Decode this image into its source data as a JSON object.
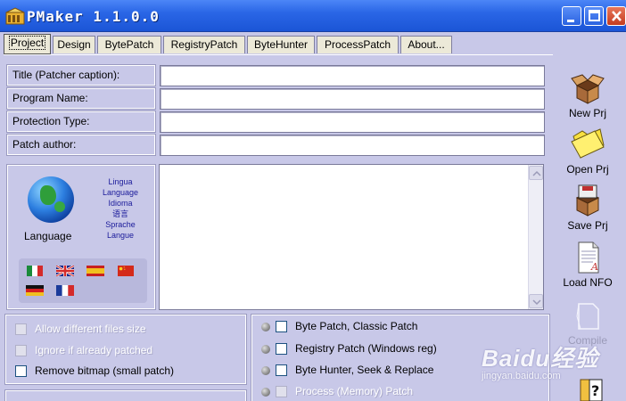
{
  "window": {
    "title": "PMaker 1.1.0.0"
  },
  "tabs": [
    {
      "label": "Project",
      "active": true
    },
    {
      "label": "Design"
    },
    {
      "label": "BytePatch"
    },
    {
      "label": "RegistryPatch"
    },
    {
      "label": "ByteHunter"
    },
    {
      "label": "ProcessPatch"
    },
    {
      "label": "About..."
    }
  ],
  "form": {
    "fields": [
      {
        "label": "Title (Patcher caption):",
        "value": ""
      },
      {
        "label": "Program Name:",
        "value": ""
      },
      {
        "label": "Protection Type:",
        "value": ""
      },
      {
        "label": "Patch author:",
        "value": ""
      }
    ]
  },
  "language": {
    "label": "Language",
    "words": [
      "Lingua",
      "Language",
      "Idioma",
      "语言",
      "Sprache",
      "Langue"
    ],
    "flags": [
      "italy-flag",
      "uk-flag",
      "spain-flag",
      "china-flag",
      "germany-flag",
      "france-flag"
    ]
  },
  "notes": {
    "value": ""
  },
  "toolbar": [
    {
      "label": "New Prj",
      "icon": "open-box-icon"
    },
    {
      "label": "Open Prj",
      "icon": "folder-icon"
    },
    {
      "label": "Save Prj",
      "icon": "save-box-icon"
    },
    {
      "label": "Load NFO",
      "icon": "document-icon"
    },
    {
      "label": "Compile",
      "icon": "compile-icon",
      "disabled": true
    },
    {
      "label": "",
      "icon": "help-icon"
    }
  ],
  "options": [
    {
      "label": "Allow different files size",
      "checked": false,
      "disabled": true
    },
    {
      "label": "Ignore if already patched",
      "checked": false,
      "disabled": true
    },
    {
      "label": "Remove bitmap (small patch)",
      "checked": false,
      "disabled": false
    }
  ],
  "patch_options": [
    {
      "label": "Byte Patch, Classic Patch",
      "checked": false,
      "disabled": false
    },
    {
      "label": "Registry Patch (Windows reg)",
      "checked": false,
      "disabled": false
    },
    {
      "label": "Byte Hunter, Seek & Replace",
      "checked": false,
      "disabled": false
    },
    {
      "label": "Process (Memory) Patch",
      "checked": false,
      "disabled": true
    }
  ],
  "watermark": {
    "main": "Baidu经验",
    "sub": "jingyan.baidu.com"
  },
  "colors": {
    "titlebar": "#2a66e6",
    "background": "#c8c8e8",
    "close": "#c43c20"
  }
}
